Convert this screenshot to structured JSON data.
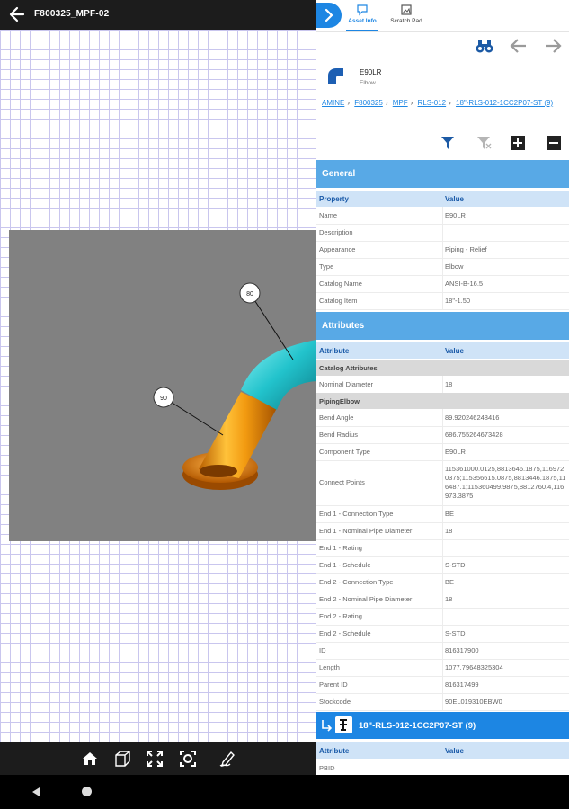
{
  "viewer": {
    "title": "F800325_MPF-02",
    "callouts": [
      "80",
      "90"
    ],
    "toolbar": [
      "home-icon",
      "cube-icon",
      "fit-icon",
      "zoom-icon",
      "markup-icon"
    ]
  },
  "panel": {
    "tabs": [
      {
        "label": "Asset Info",
        "icon": "info-icon",
        "active": true
      },
      {
        "label": "Scratch Pad",
        "icon": "image-icon",
        "active": false
      }
    ],
    "asset": {
      "name": "E90LR",
      "type": "Elbow"
    },
    "breadcrumb": [
      "AMINE",
      "F800325",
      "MPF",
      "RLS-012",
      "18\"-RLS-012-1CC2P07-ST (9)"
    ],
    "general": {
      "title": "General",
      "col_property": "Property",
      "col_value": "Value",
      "rows": [
        {
          "k": "Name",
          "v": "E90LR"
        },
        {
          "k": "Description",
          "v": ""
        },
        {
          "k": "Appearance",
          "v": "Piping - Relief"
        },
        {
          "k": "Type",
          "v": "Elbow"
        },
        {
          "k": "Catalog Name",
          "v": "ANSI-B-16.5"
        },
        {
          "k": "Catalog Item",
          "v": "18\"-1.50"
        }
      ]
    },
    "attributes": {
      "title": "Attributes",
      "col_attr": "Attribute",
      "col_value": "Value",
      "group1": "Catalog Attributes",
      "group1_rows": [
        {
          "k": "Nominal Diameter",
          "v": "18"
        }
      ],
      "group2": "PipingElbow",
      "group2_rows": [
        {
          "k": "Bend Angle",
          "v": "89.920246248416"
        },
        {
          "k": "Bend Radius",
          "v": "686.755264673428"
        },
        {
          "k": "Component Type",
          "v": "E90LR"
        },
        {
          "k": "Connect Points",
          "v": "115361000.0125,8813646.1875,116972.0375;115356615.0875,8813446.1875,116487.1;115360499.9875,8812760.4,116973.3875"
        },
        {
          "k": "End 1 - Connection Type",
          "v": "BE"
        },
        {
          "k": "End 1 - Nominal Pipe Diameter",
          "v": "18"
        },
        {
          "k": "End 1 - Rating",
          "v": ""
        },
        {
          "k": "End 1 - Schedule",
          "v": "S-STD"
        },
        {
          "k": "End 2 - Connection Type",
          "v": "BE"
        },
        {
          "k": "End 2 - Nominal Pipe Diameter",
          "v": "18"
        },
        {
          "k": "End 2 - Rating",
          "v": ""
        },
        {
          "k": "End 2 - Schedule",
          "v": "S-STD"
        },
        {
          "k": "ID",
          "v": "816317900"
        },
        {
          "k": "Length",
          "v": "1077.79648325304"
        },
        {
          "k": "Parent ID",
          "v": "816317499"
        },
        {
          "k": "Stockcode",
          "v": "90EL019310EBW0"
        }
      ]
    },
    "related": {
      "title": "18\"-RLS-012-1CC2P07-ST (9)",
      "col_attr": "Attribute",
      "col_value": "Value",
      "partial_row": "PBID"
    }
  },
  "colors": {
    "accent": "#1d86e3",
    "section": "#58a9e6",
    "pipe_orange": "#f08c00",
    "pipe_cyan": "#1fb8c6"
  }
}
